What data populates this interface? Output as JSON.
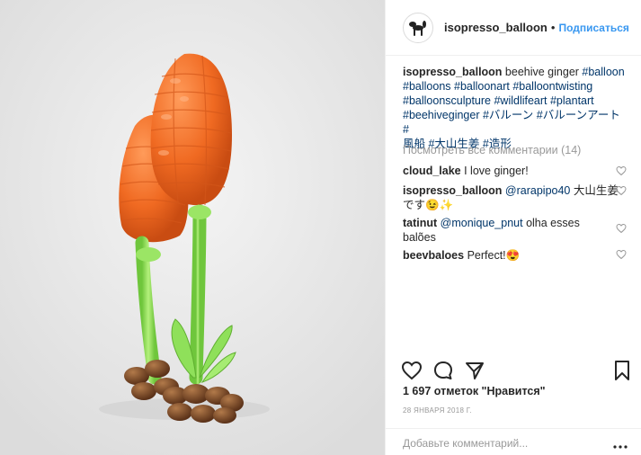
{
  "post": {
    "username": "isopresso_balloon",
    "follow_label": "Подписаться",
    "dot": "•"
  },
  "caption": {
    "username": "isopresso_balloon",
    "line1_text": " beehive ginger ",
    "line1_tag": "#balloon",
    "line2": "#balloons #balloonart #balloontwisting",
    "line3": "#balloonsculpture #wildlifeart #plantart",
    "line4": "#beehiveginger #バルーン #バルーンアート #",
    "line5": "風船 #大山生姜 #造形"
  },
  "view_all_comments": "Посмотреть все комментарии (14)",
  "comments": [
    {
      "user": "cloud_lake",
      "text": " I love ginger!"
    },
    {
      "user": "isopresso_balloon",
      "mention": " @rarapipo40",
      "text": " 大山生姜",
      "text2": "です😉✨"
    },
    {
      "user": "tatinut",
      "mention": " @monique_pnut",
      "text": " olha esses",
      "text2": "balões"
    },
    {
      "user": "beevbaloes",
      "text": " Perfect!😍"
    }
  ],
  "likes": "1 697 отметок \"Нравится\"",
  "date": "28 ЯНВАРЯ 2018 Г.",
  "add_comment_placeholder": "Добавьте комментарий...",
  "more_label": "···",
  "icons": {
    "avatar": "balloon-dog-avatar",
    "like": "heart-icon",
    "comment": "comment-bubble-icon",
    "share": "share-arrow-icon",
    "save": "bookmark-icon"
  },
  "colors": {
    "link": "#3897f0",
    "hashtag": "#003569",
    "muted": "#999999",
    "balloon_orange": "#f06a22",
    "stem_green": "#8fe05a",
    "base_brown": "#7a4a28"
  }
}
